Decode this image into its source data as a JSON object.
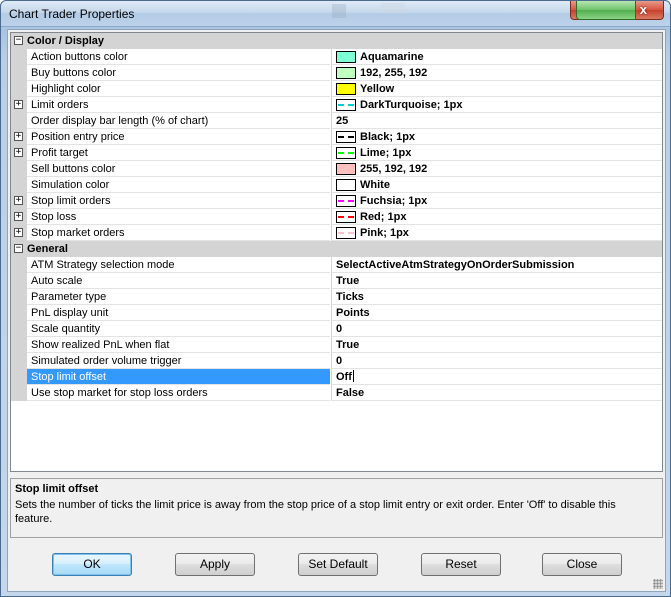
{
  "window": {
    "title": "Chart Trader Properties",
    "close_glyph": "x"
  },
  "grid": {
    "categories": [
      {
        "label": "Color / Display",
        "expander": "−",
        "rows": [
          {
            "name": "Action buttons color",
            "value": "Aquamarine",
            "swatch": "#7fffd4"
          },
          {
            "name": "Buy buttons color",
            "value": "192, 255, 192",
            "swatch": "#c0ffc0"
          },
          {
            "name": "Highlight color",
            "value": "Yellow",
            "swatch": "#ffff00"
          },
          {
            "name": "Limit orders",
            "value": "DarkTurquoise; 1px",
            "dash": "#00ced1",
            "expander": "+"
          },
          {
            "name": "Order display bar length (% of chart)",
            "value": "25"
          },
          {
            "name": "Position entry price",
            "value": "Black; 1px",
            "dash": "#000000",
            "expander": "+"
          },
          {
            "name": "Profit target",
            "value": "Lime; 1px",
            "dash": "#00ff00",
            "expander": "+"
          },
          {
            "name": "Sell buttons color",
            "value": "255, 192, 192",
            "swatch": "#ffc0c0"
          },
          {
            "name": "Simulation color",
            "value": "White",
            "swatch": "#ffffff"
          },
          {
            "name": "Stop limit orders",
            "value": "Fuchsia; 1px",
            "dash": "#ff00ff",
            "expander": "+"
          },
          {
            "name": "Stop loss",
            "value": "Red; 1px",
            "dash": "#ff0000",
            "expander": "+"
          },
          {
            "name": "Stop market orders",
            "value": "Pink; 1px",
            "dash": "#ffc0cb",
            "expander": "+"
          }
        ]
      },
      {
        "label": "General",
        "expander": "−",
        "rows": [
          {
            "name": "ATM Strategy selection mode",
            "value": "SelectActiveAtmStrategyOnOrderSubmission"
          },
          {
            "name": "Auto scale",
            "value": "True"
          },
          {
            "name": "Parameter type",
            "value": "Ticks"
          },
          {
            "name": "PnL display unit",
            "value": "Points"
          },
          {
            "name": "Scale quantity",
            "value": "0"
          },
          {
            "name": "Show realized PnL when flat",
            "value": "True"
          },
          {
            "name": "Simulated order volume trigger",
            "value": "0"
          },
          {
            "name": "Stop limit offset",
            "value": "Off",
            "selected": true
          },
          {
            "name": "Use stop market for stop loss orders",
            "value": "False"
          }
        ]
      }
    ]
  },
  "description": {
    "title": "Stop limit offset",
    "text": "Sets the number of ticks the limit price is away from the stop price of a stop limit entry or exit order. Enter 'Off' to disable this feature."
  },
  "buttons": {
    "ok": "OK",
    "apply": "Apply",
    "set_default": "Set Default",
    "reset": "Reset",
    "close": "Close"
  }
}
